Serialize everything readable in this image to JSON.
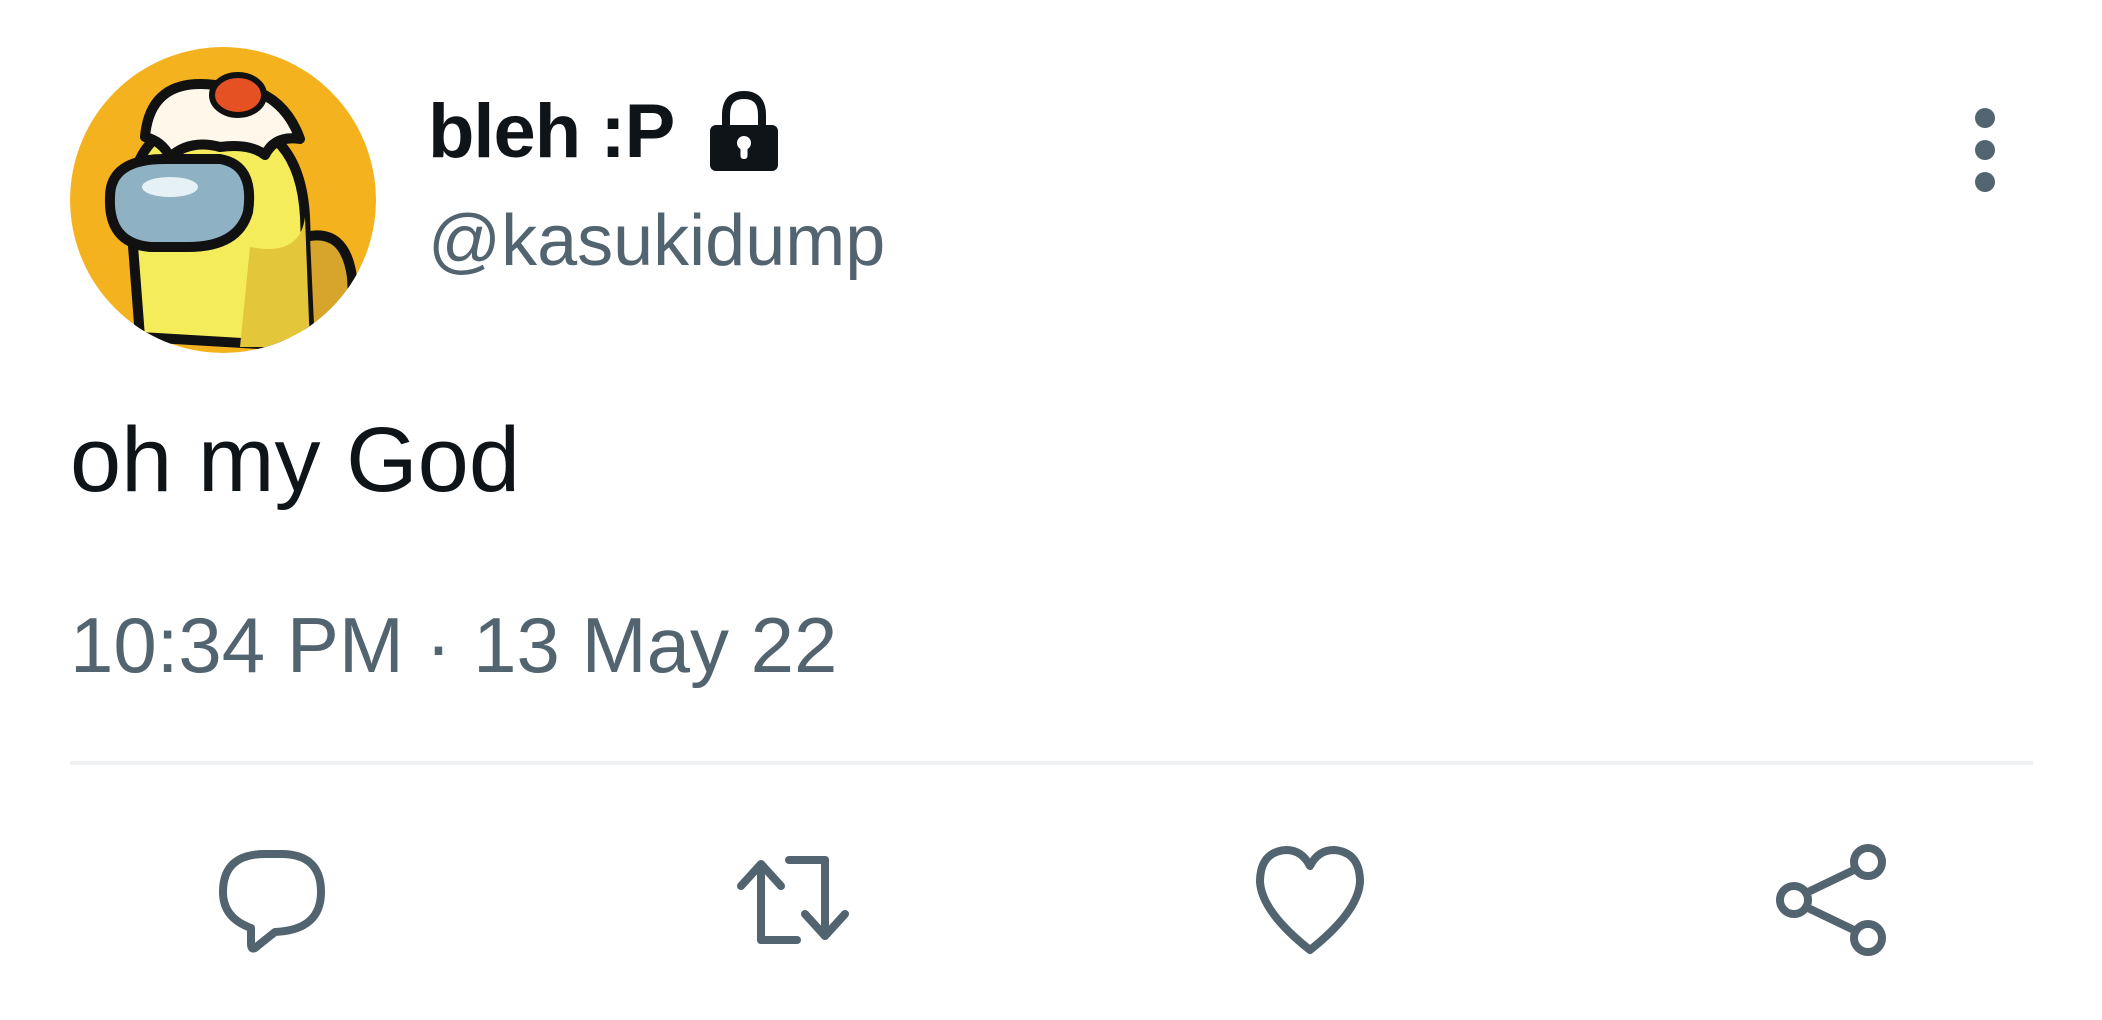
{
  "tweet": {
    "author": {
      "display_name": "bleh :P",
      "handle": "@kasukidump",
      "protected_icon": "lock-icon",
      "avatar": "yellow among-us crewmate with fried egg hat"
    },
    "text": "oh my God",
    "timestamp": "10:34 PM · 13 May 22"
  },
  "actions": {
    "more": "more-vertical-icon",
    "reply": "reply-icon",
    "retweet": "retweet-icon",
    "like": "heart-icon",
    "share": "share-icon"
  },
  "colors": {
    "text_primary": "#0f1419",
    "text_secondary": "#536471",
    "icon": "#536471",
    "divider": "#eff1f3",
    "avatar_bg": "#f5b21f"
  }
}
